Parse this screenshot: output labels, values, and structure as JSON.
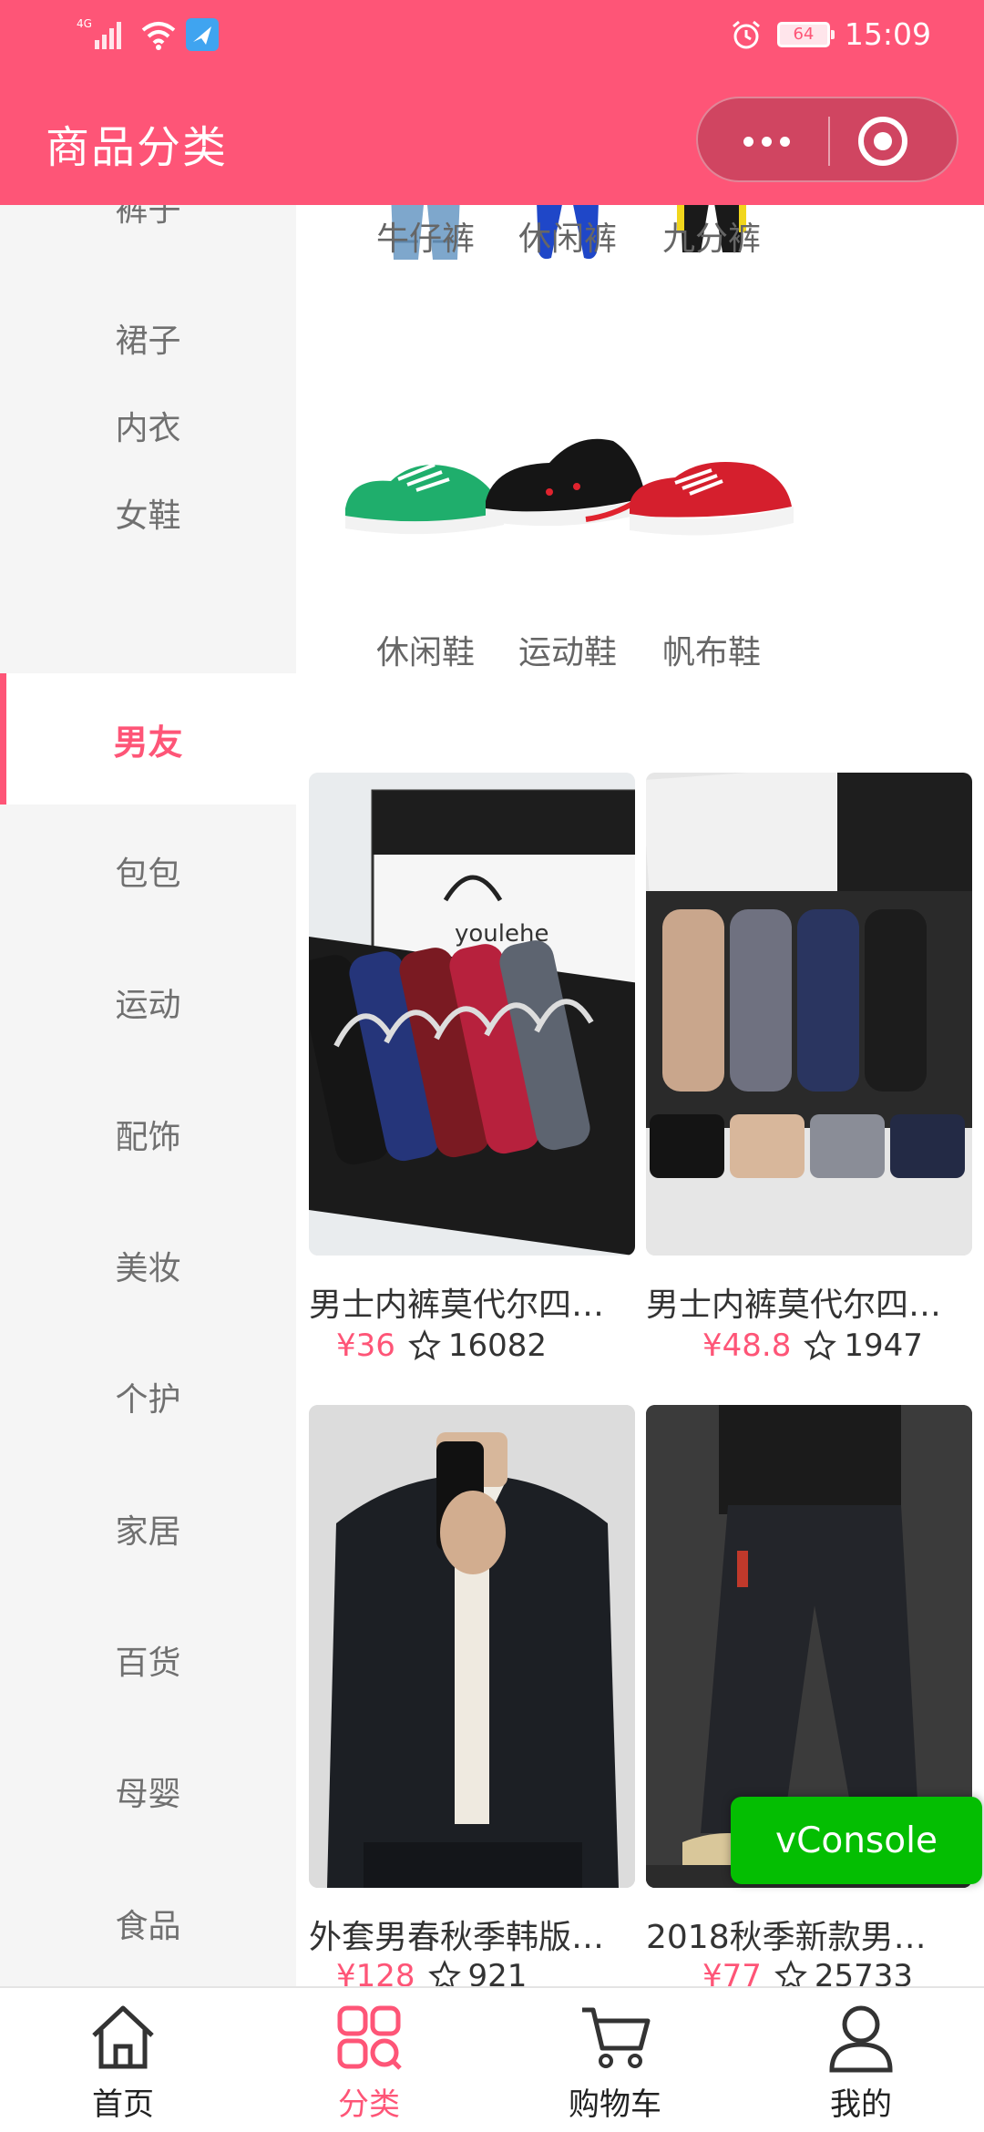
{
  "status_bar": {
    "network": "4G",
    "battery": "64",
    "time": "15:09"
  },
  "nav": {
    "title": "商品分类"
  },
  "sidebar": {
    "items": [
      {
        "label": "裤子"
      },
      {
        "label": "裙子"
      },
      {
        "label": "内衣"
      },
      {
        "label": "女鞋"
      },
      {
        "label": "男友",
        "active": true
      },
      {
        "label": "包包"
      },
      {
        "label": "运动"
      },
      {
        "label": "配饰"
      },
      {
        "label": "美妆"
      },
      {
        "label": "个护"
      },
      {
        "label": "家居"
      },
      {
        "label": "百货"
      },
      {
        "label": "母婴"
      },
      {
        "label": "食品"
      }
    ]
  },
  "subcategories": [
    {
      "label": "牛仔裤",
      "icon": "jeans-image"
    },
    {
      "label": "休闲裤",
      "icon": "casual-pants-image"
    },
    {
      "label": "九分裤",
      "icon": "cropped-pants-image"
    },
    {
      "label": "休闲鞋",
      "icon": "casual-shoes-image"
    },
    {
      "label": "运动鞋",
      "icon": "sports-shoes-image"
    },
    {
      "label": "帆布鞋",
      "icon": "canvas-shoes-image"
    }
  ],
  "products": [
    {
      "title": "男士内裤莫代尔四…",
      "price": "¥36",
      "favorites": "16082"
    },
    {
      "title": "男士内裤莫代尔四…",
      "price": "¥48.8",
      "favorites": "1947"
    },
    {
      "title": "外套男春秋季韩版…",
      "price": "¥128",
      "favorites": "921"
    },
    {
      "title": "2018秋季新款男…",
      "price": "¥77",
      "favorites": "25733"
    }
  ],
  "vconsole": {
    "label": "vConsole"
  },
  "tabbar": {
    "tabs": [
      {
        "label": "首页",
        "icon": "home-icon"
      },
      {
        "label": "分类",
        "icon": "category-icon",
        "active": true
      },
      {
        "label": "购物车",
        "icon": "cart-icon"
      },
      {
        "label": "我的",
        "icon": "user-icon"
      }
    ]
  },
  "colors": {
    "accent": "#fe5577",
    "sidebar_bg": "#f5f5f5",
    "vconsole": "#04be02"
  }
}
